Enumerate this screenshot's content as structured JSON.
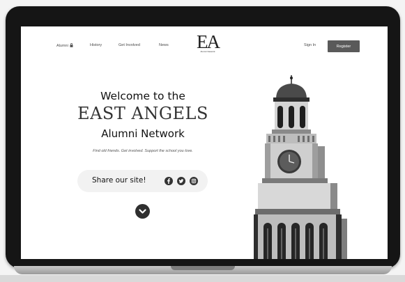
{
  "nav": {
    "links": [
      "Alumni",
      "History",
      "Get Involved",
      "News"
    ],
    "signin": "Sign In",
    "register": "Register"
  },
  "logo": {
    "mark": "EA",
    "subtitle": "Alumni Network"
  },
  "hero": {
    "line1": "Welcome to the",
    "line2": "EAST ANGELS",
    "line3": "Alumni Network",
    "tagline": "Find old friends.  Get involved.  Support the school you love."
  },
  "share": {
    "label": "Share our site!",
    "icons": [
      "facebook-icon",
      "twitter-icon",
      "instagram-icon"
    ]
  },
  "icons": {
    "scroll": "chevron-down-icon",
    "lock": "lock-icon"
  },
  "colors": {
    "register_bg": "#5a5a5a",
    "bezel": "#151515",
    "screen_bg": "#ffffff"
  }
}
